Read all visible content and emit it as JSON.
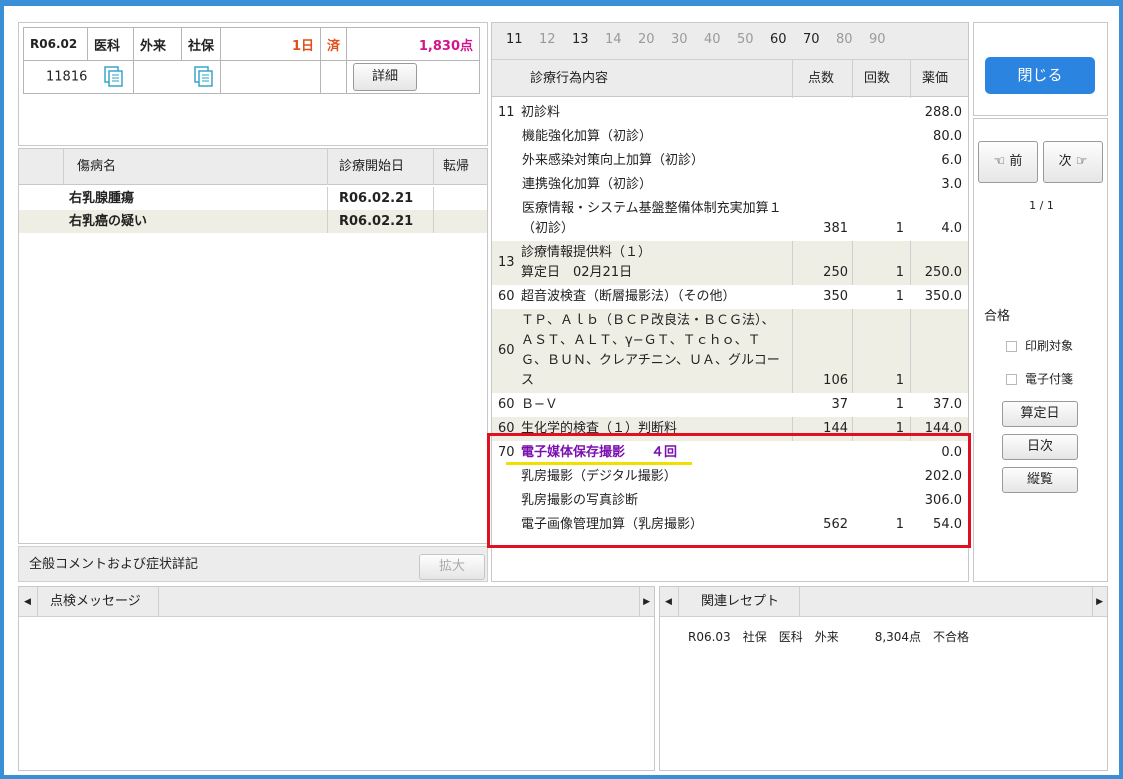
{
  "header": {
    "date": "R06.02",
    "kind": "医科",
    "visit": "外来",
    "insurance": "社保",
    "days": "1日",
    "status": "済",
    "points": "1,830点",
    "patient_id": "11816",
    "detail_button": "詳細"
  },
  "disease": {
    "columns": [
      "傷病名",
      "診療開始日",
      "転帰"
    ],
    "rows": [
      {
        "name": "右乳腺腫瘍",
        "date": "R06.02.21",
        "outcome": ""
      },
      {
        "name": "右乳癌の疑い",
        "date": "R06.02.21",
        "outcome": ""
      }
    ]
  },
  "comment": {
    "label": "全般コメントおよび症状詳記",
    "expand_button": "拡大"
  },
  "codes": {
    "tabs": [
      {
        "label": "11",
        "active": true
      },
      {
        "label": "12",
        "active": false
      },
      {
        "label": "13",
        "active": true
      },
      {
        "label": "14",
        "active": false
      },
      {
        "label": "20",
        "active": false
      },
      {
        "label": "30",
        "active": false
      },
      {
        "label": "40",
        "active": false
      },
      {
        "label": "50",
        "active": false
      },
      {
        "label": "60",
        "active": true
      },
      {
        "label": "70",
        "active": true
      },
      {
        "label": "80",
        "active": false
      },
      {
        "label": "90",
        "active": false
      }
    ],
    "columns": {
      "content": "診療行為内容",
      "points": "点数",
      "count": "回数",
      "price": "薬価"
    },
    "rows": [
      {
        "code": "11",
        "lines": [
          "初診料"
        ],
        "points": "",
        "count": "",
        "price": "288.0",
        "indent": false
      },
      {
        "code": "",
        "lines": [
          "機能強化加算（初診）"
        ],
        "points": "",
        "count": "",
        "price": "80.0",
        "indent": true
      },
      {
        "code": "",
        "lines": [
          "外来感染対策向上加算（初診）"
        ],
        "points": "",
        "count": "",
        "price": "6.0",
        "indent": true
      },
      {
        "code": "",
        "lines": [
          "連携強化加算（初診）"
        ],
        "points": "",
        "count": "",
        "price": "3.0",
        "indent": true
      },
      {
        "code": "",
        "lines": [
          "医療情報・システム基盤整備体制充実加算１",
          "（初診）"
        ],
        "points": "381",
        "count": "1",
        "price": "4.0",
        "indent": true
      },
      {
        "code": "13",
        "lines": [
          "診療情報提供料（１）",
          "算定日　02月21日"
        ],
        "points": "250",
        "count": "1",
        "price": "250.0",
        "indent": false
      },
      {
        "code": "60",
        "lines": [
          "超音波検査（断層撮影法）（その他）"
        ],
        "points": "350",
        "count": "1",
        "price": "350.0",
        "indent": false
      },
      {
        "code": "60",
        "lines": [
          "ＴＰ、Ａｌｂ（ＢＣＰ改良法・ＢＣＧ法）、",
          "ＡＳＴ、ＡＬＴ、γ−ＧＴ、Ｔｃｈｏ、Ｔ",
          "Ｇ、ＢＵＮ、クレアチニン、ＵＡ、グルコー",
          "ス"
        ],
        "points": "106",
        "count": "1",
        "price": "",
        "indent": false
      },
      {
        "code": "60",
        "lines": [
          "Ｂ−Ｖ"
        ],
        "points": "37",
        "count": "1",
        "price": "37.0",
        "indent": false
      },
      {
        "code": "60",
        "lines": [
          "生化学的検査（１）判断料"
        ],
        "points": "144",
        "count": "1",
        "price": "144.0",
        "indent": false
      },
      {
        "code": "70",
        "lines": [
          "電子媒体保存撮影　　４回"
        ],
        "points": "",
        "count": "",
        "price": "0.0",
        "indent": false,
        "highlight": true
      },
      {
        "code": "",
        "lines": [
          "乳房撮影（デジタル撮影）"
        ],
        "points": "",
        "count": "",
        "price": "202.0",
        "indent": false
      },
      {
        "code": "",
        "lines": [
          "乳房撮影の写真診断"
        ],
        "points": "",
        "count": "",
        "price": "306.0",
        "indent": false
      },
      {
        "code": "",
        "lines": [
          "電子画像管理加算（乳房撮影）"
        ],
        "points": "562",
        "count": "1",
        "price": "54.0",
        "indent": false
      }
    ]
  },
  "side": {
    "close_button": "閉じる",
    "prev_button": "☜ 前",
    "next_button": "次 ☞",
    "pager": "1 / 1",
    "result": "合格",
    "print_target": "印刷対象",
    "e_note": "電子付箋",
    "calc_day_button": "算定日",
    "daily_button": "日次",
    "vertical_button": "縦覧"
  },
  "bottom": {
    "message_tab": "点検メッセージ",
    "related_tab": "関連レセプト",
    "related_row": "R06.03　社保　医科　外来　　　8,304点　不合格"
  },
  "colors": {
    "accent": "#3a8fd6",
    "close_button": "#2b84e0",
    "points": "#d4148c",
    "days": "#e0501a",
    "highlight_text": "#7a10b0",
    "red_box": "#e01020",
    "underline": "#f0e000"
  }
}
